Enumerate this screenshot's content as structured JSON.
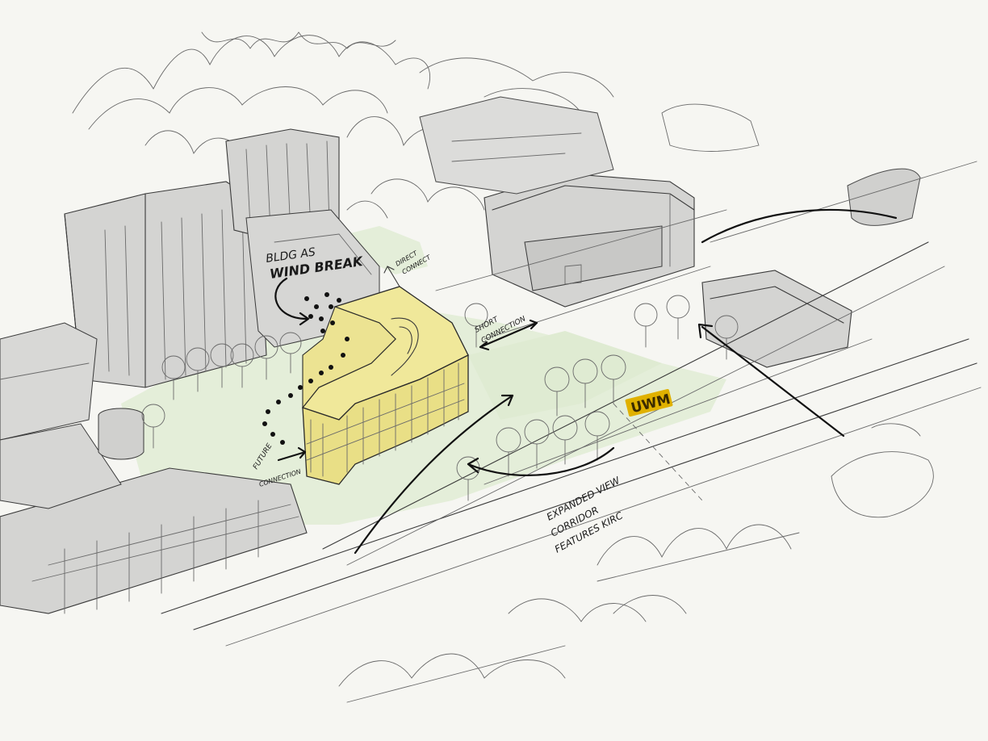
{
  "annotations": {
    "wind_break_line1": "BLDG AS",
    "wind_break_line2": "WIND BREAK",
    "direct_connect_line1": "DIRECT",
    "direct_connect_line2": "CONNECT",
    "short_connection_line1": "SHORT",
    "short_connection_line2": "CONNECTION",
    "future_connection_line1": "FUTURE",
    "future_connection_line2": "CONNECTION",
    "view_corridor_line1": "EXPANDED VIEW",
    "view_corridor_line2": "CORRIDOR",
    "view_corridor_line3": "FEATURES KIRC"
  },
  "logo": {
    "text": "UWM"
  },
  "colors": {
    "background": "#f6f6f2",
    "building_gray": "#d4d4d2",
    "building_shadow": "#b9b9b7",
    "lawn_green": "#e2edd6",
    "proposed_building_yellow": "#f1ea9c",
    "logo_gold": "#e0b100",
    "ink": "#2a2a2a"
  },
  "icons": {
    "view_arrow": "arrow-icon",
    "connection_arrow": "double-arrow-icon"
  }
}
